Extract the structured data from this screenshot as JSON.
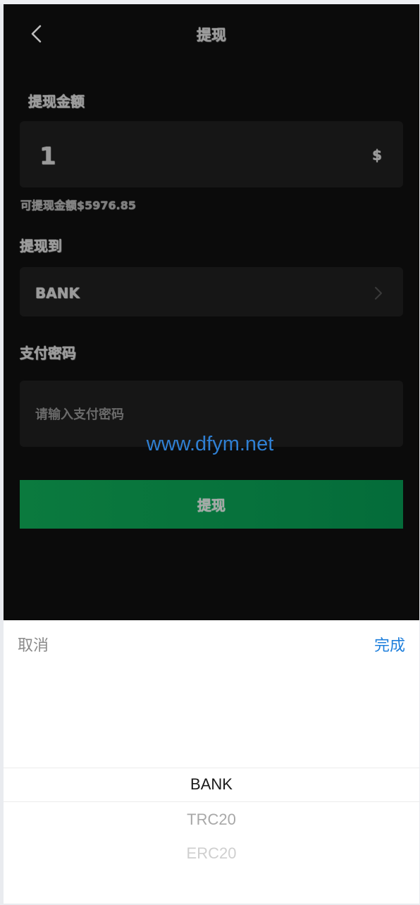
{
  "header": {
    "title": "提现"
  },
  "form": {
    "amount_label": "提现金额",
    "amount_value": "1",
    "currency_symbol": "$",
    "available_text": "可提现金额$5976.85",
    "method_label": "提现到",
    "method_value": "BANK",
    "password_label": "支付密码",
    "password_placeholder": "请输入支付密码",
    "submit_label": "提现"
  },
  "watermark": "www.dfym.net",
  "picker": {
    "cancel_label": "取消",
    "confirm_label": "完成",
    "options": [
      {
        "label": "BANK",
        "state": "selected"
      },
      {
        "label": "TRC20",
        "state": "near"
      },
      {
        "label": "ERC20",
        "state": "far"
      }
    ]
  },
  "colors": {
    "background": "#0b0b0b",
    "field": "#161616",
    "submit": "#046c3a",
    "confirm": "#1e7fdc",
    "watermark": "#2f7fd2"
  },
  "icons": {
    "back": "chevron-left-icon",
    "method_arrow": "chevron-right-icon"
  }
}
